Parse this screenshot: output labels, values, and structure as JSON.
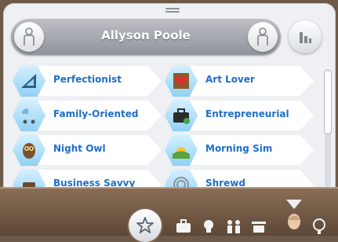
{
  "sim": {
    "name": "Allyson Poole"
  },
  "traits": [
    {
      "label": "Perfectionist",
      "icon": "ruler-triangle-icon"
    },
    {
      "label": "Art Lover",
      "icon": "heart-painting-icon"
    },
    {
      "label": "Family-Oriented",
      "icon": "stroller-icon"
    },
    {
      "label": "Entrepreneurial",
      "icon": "briefcase-icon"
    },
    {
      "label": "Night Owl",
      "icon": "owl-icon"
    },
    {
      "label": "Morning Sim",
      "icon": "sunrise-icon"
    },
    {
      "label": "Business Savvy",
      "icon": "business-icon"
    },
    {
      "label": "Shrewd",
      "icon": "spiral-icon"
    }
  ],
  "bottom_tabs": [
    "favorite-star-icon",
    "career-briefcase-icon",
    "skills-lightbulb-icon",
    "relationships-people-icon",
    "inventory-box-icon",
    "simology-head-icon",
    "aspiration-icon"
  ],
  "colors": {
    "trait_text": "#1f6fc6",
    "hex_bg": "#8ed0f4",
    "wood": "#6e5a48"
  }
}
